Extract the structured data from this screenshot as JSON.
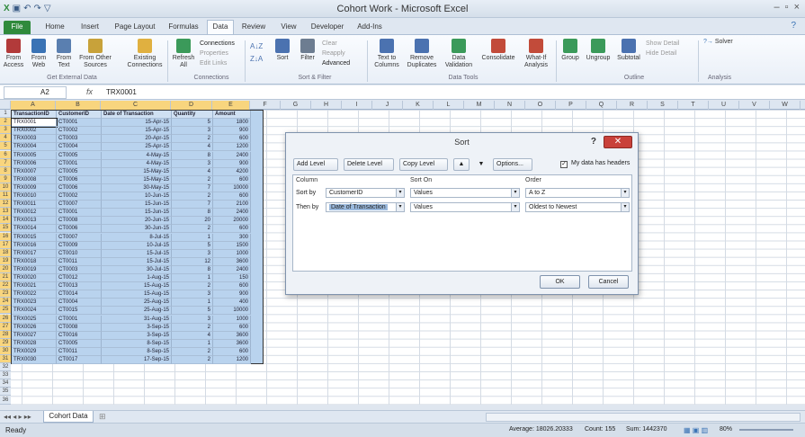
{
  "window": {
    "title": "Cohort Work - Microsoft Excel",
    "controls": [
      "–",
      "▫",
      "×"
    ]
  },
  "tabs": [
    "File",
    "Home",
    "Insert",
    "Page Layout",
    "Formulas",
    "Data",
    "Review",
    "View",
    "Developer",
    "Add-Ins"
  ],
  "active_tab": "Data",
  "ribbon": {
    "buttons": [
      {
        "label": "From Access",
        "color": "#b23a3a"
      },
      {
        "label": "From Web",
        "color": "#3a73b5"
      },
      {
        "label": "From Text",
        "color": "#5a7fb0"
      },
      {
        "label": "From Other Sources",
        "color": "#c8a23a"
      },
      {
        "label": "Existing Connections",
        "color": "#e0b040"
      },
      {
        "label": "Refresh All",
        "color": "#3b9a5a"
      },
      {
        "label": "Sort",
        "color": "#4b72b0"
      },
      {
        "label": "Filter",
        "color": "#6d7d91"
      },
      {
        "label": "Text to Columns",
        "color": "#4b72b0"
      },
      {
        "label": "Remove Duplicates",
        "color": "#4b72b0"
      },
      {
        "label": "Data Validation",
        "color": "#3b9a5a"
      },
      {
        "label": "Consolidate",
        "color": "#c24b3a"
      },
      {
        "label": "What-If Analysis",
        "color": "#c24b3a"
      },
      {
        "label": "Group",
        "color": "#3b9a5a"
      },
      {
        "label": "Ungroup",
        "color": "#3b9a5a"
      },
      {
        "label": "Subtotal",
        "color": "#4b72b0"
      }
    ],
    "small": {
      "connections": [
        "Connections",
        "Properties",
        "Edit Links"
      ],
      "filter": [
        "Clear",
        "Reapply",
        "Advanced"
      ],
      "outline": [
        "Show Detail",
        "Hide Detail"
      ],
      "analysis": "Solver"
    },
    "groups": [
      "Get External Data",
      "Connections",
      "Sort & Filter",
      "Data Tools",
      "Outline",
      "Analysis"
    ]
  },
  "formula_bar": {
    "name_box": "A2",
    "fx": "fx",
    "value": "TRX0001"
  },
  "columns": [
    "A",
    "B",
    "C",
    "D",
    "E",
    "F",
    "G",
    "H",
    "I",
    "J",
    "K",
    "L",
    "M",
    "N",
    "O",
    "P",
    "Q",
    "R",
    "S",
    "T",
    "U",
    "V",
    "W"
  ],
  "headers": [
    "TransactionID",
    "CustomerID",
    "Date of Transaction",
    "Quantity",
    "Amount"
  ],
  "rows": [
    [
      "TRX0001",
      "CT0001",
      "15-Apr-15",
      "5",
      "1800"
    ],
    [
      "TRX0002",
      "CT0002",
      "15-Apr-15",
      "3",
      "900"
    ],
    [
      "TRX0003",
      "CT0003",
      "20-Apr-15",
      "2",
      "600"
    ],
    [
      "TRX0004",
      "CT0004",
      "25-Apr-15",
      "4",
      "1200"
    ],
    [
      "TRX0005",
      "CT0005",
      "4-May-15",
      "8",
      "2400"
    ],
    [
      "TRX0006",
      "CT0001",
      "4-May-15",
      "3",
      "900"
    ],
    [
      "TRX0007",
      "CT0005",
      "15-May-15",
      "4",
      "4200"
    ],
    [
      "TRX0008",
      "CT0006",
      "15-May-15",
      "2",
      "600"
    ],
    [
      "TRX0009",
      "CT0006",
      "30-May-15",
      "7",
      "10000"
    ],
    [
      "TRX0010",
      "CT0002",
      "10-Jun-15",
      "2",
      "600"
    ],
    [
      "TRX0011",
      "CT0007",
      "15-Jun-15",
      "7",
      "2100"
    ],
    [
      "TRX0012",
      "CT0001",
      "15-Jun-15",
      "8",
      "2400"
    ],
    [
      "TRX0013",
      "CT0008",
      "20-Jun-15",
      "20",
      "20000"
    ],
    [
      "TRX0014",
      "CT0006",
      "30-Jun-15",
      "2",
      "600"
    ],
    [
      "TRX0015",
      "CT0007",
      "8-Jul-15",
      "1",
      "300"
    ],
    [
      "TRX0016",
      "CT0009",
      "10-Jul-15",
      "5",
      "1500"
    ],
    [
      "TRX0017",
      "CT0010",
      "15-Jul-15",
      "3",
      "1000"
    ],
    [
      "TRX0018",
      "CT0011",
      "15-Jul-15",
      "12",
      "3600"
    ],
    [
      "TRX0019",
      "CT0003",
      "30-Jul-15",
      "8",
      "2400"
    ],
    [
      "TRX0020",
      "CT0012",
      "1-Aug-15",
      "1",
      "150"
    ],
    [
      "TRX0021",
      "CT0013",
      "15-Aug-15",
      "2",
      "600"
    ],
    [
      "TRX0022",
      "CT0014",
      "15-Aug-15",
      "3",
      "900"
    ],
    [
      "TRX0023",
      "CT0004",
      "25-Aug-15",
      "1",
      "400"
    ],
    [
      "TRX0024",
      "CT0015",
      "25-Aug-15",
      "5",
      "10000"
    ],
    [
      "TRX0025",
      "CT0001",
      "31-Aug-15",
      "3",
      "1000"
    ],
    [
      "TRX0026",
      "CT0008",
      "3-Sep-15",
      "2",
      "600"
    ],
    [
      "TRX0027",
      "CT0016",
      "3-Sep-15",
      "4",
      "3600"
    ],
    [
      "TRX0028",
      "CT0005",
      "8-Sep-15",
      "1",
      "3600"
    ],
    [
      "TRX0029",
      "CT0011",
      "8-Sep-15",
      "2",
      "600"
    ],
    [
      "TRX0030",
      "CT0017",
      "17-Sep-15",
      "2",
      "1200"
    ]
  ],
  "sheet_tab": "Cohort Data",
  "status": {
    "left": "Ready",
    "average": "Average: 18026.20333",
    "count": "Count: 155",
    "sum": "Sum: 1442370",
    "zoom": "80%"
  },
  "sort_dialog": {
    "title": "Sort",
    "help": "?",
    "close": "✕",
    "buttons": [
      "Add Level",
      "Delete Level",
      "Copy Level",
      "▲",
      "▼",
      "Options..."
    ],
    "has_headers_label": "My data has headers",
    "has_headers_checked": true,
    "col_headers": [
      "Column",
      "Sort On",
      "Order"
    ],
    "levels": [
      {
        "label": "Sort by",
        "column": "CustomerID",
        "sort_on": "Values",
        "order": "A to Z"
      },
      {
        "label": "Then by",
        "column": "Date of Transaction",
        "sort_on": "Values",
        "order": "Oldest to Newest"
      }
    ],
    "ok": "OK",
    "cancel": "Cancel"
  }
}
